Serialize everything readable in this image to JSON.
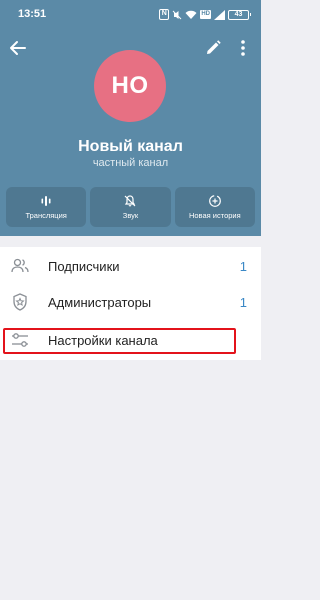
{
  "status_bar": {
    "time": "13:51",
    "nfc": "N",
    "network": "HD",
    "battery": "43"
  },
  "header": {
    "avatar_initials": "НО",
    "channel_title": "Новый канал",
    "channel_subtitle": "частный канал",
    "avatar_color": "#e77083",
    "background_color": "#5b8aa7"
  },
  "actions": [
    {
      "label": "Трансляция",
      "icon": "broadcast-icon"
    },
    {
      "label": "Звук",
      "icon": "bell-off-icon"
    },
    {
      "label": "Новая история",
      "icon": "new-story-icon"
    }
  ],
  "list": [
    {
      "label": "Подписчики",
      "count": "1",
      "icon": "users-icon"
    },
    {
      "label": "Администраторы",
      "count": "1",
      "icon": "shield-star-icon"
    },
    {
      "label": "Настройки канала",
      "icon": "sliders-icon"
    }
  ],
  "colors": {
    "accent": "#3a88c6",
    "highlight": "#e3131b"
  }
}
